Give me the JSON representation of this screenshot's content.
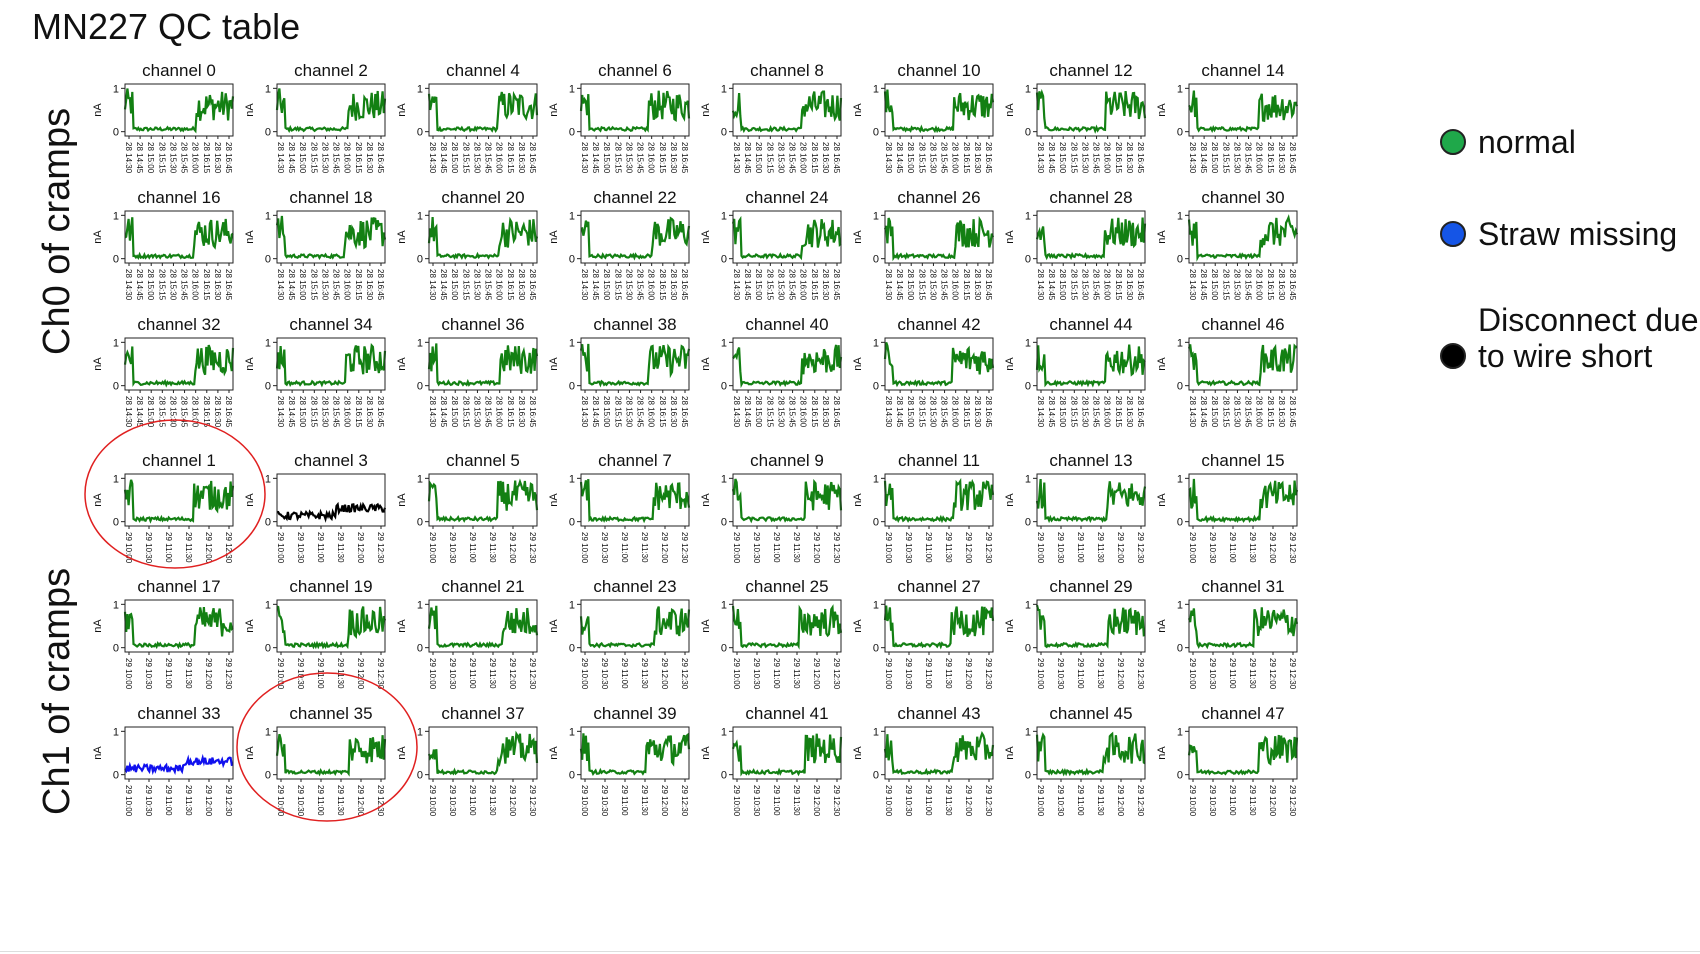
{
  "title": "MN227 QC table",
  "group_labels": {
    "ch0": "Ch0 of cramps",
    "ch1": "Ch1 of cramps"
  },
  "legend": [
    {
      "label": "normal",
      "color": "#1fa84a"
    },
    {
      "label": "Straw missing",
      "color": "#1555e6"
    },
    {
      "label": "Disconnect due",
      "label2": "to wire short",
      "color": "#000000"
    }
  ],
  "chart_data": {
    "type": "line",
    "ylabel": "nA",
    "yticks": [
      "0",
      "1"
    ],
    "ylim": [
      -0.1,
      1.1
    ],
    "xticks_ch0": [
      "28 14:30",
      "28 14:45",
      "28 15:00",
      "28 15:15",
      "28 15:30",
      "28 15:45",
      "28 16:00",
      "28 16:15",
      "28 16:30",
      "28 16:45"
    ],
    "xticks_ch1": [
      "29 10:00",
      "29 10:30",
      "29 11:00",
      "29 11:30",
      "29 12:00",
      "29 12:30"
    ],
    "colors": {
      "normal": "#138013",
      "missing": "#1010ee",
      "disconnect": "#000000"
    },
    "panels": [
      {
        "title": "channel 0",
        "status": "normal",
        "highlight": false
      },
      {
        "title": "channel 2",
        "status": "normal",
        "highlight": false
      },
      {
        "title": "channel 4",
        "status": "normal",
        "highlight": false
      },
      {
        "title": "channel 6",
        "status": "normal",
        "highlight": false
      },
      {
        "title": "channel 8",
        "status": "normal",
        "highlight": false
      },
      {
        "title": "channel 10",
        "status": "normal",
        "highlight": false
      },
      {
        "title": "channel 12",
        "status": "normal",
        "highlight": false
      },
      {
        "title": "channel 14",
        "status": "normal",
        "highlight": false
      },
      {
        "title": "channel 16",
        "status": "normal",
        "highlight": false
      },
      {
        "title": "channel 18",
        "status": "normal",
        "highlight": false
      },
      {
        "title": "channel 20",
        "status": "normal",
        "highlight": false
      },
      {
        "title": "channel 22",
        "status": "normal",
        "highlight": false
      },
      {
        "title": "channel 24",
        "status": "normal",
        "highlight": false
      },
      {
        "title": "channel 26",
        "status": "normal",
        "highlight": false
      },
      {
        "title": "channel 28",
        "status": "normal",
        "highlight": false
      },
      {
        "title": "channel 30",
        "status": "normal",
        "highlight": false
      },
      {
        "title": "channel 32",
        "status": "normal",
        "highlight": false
      },
      {
        "title": "channel 34",
        "status": "normal",
        "highlight": false
      },
      {
        "title": "channel 36",
        "status": "normal",
        "highlight": false
      },
      {
        "title": "channel 38",
        "status": "normal",
        "highlight": false
      },
      {
        "title": "channel 40",
        "status": "normal",
        "highlight": false
      },
      {
        "title": "channel 42",
        "status": "normal",
        "highlight": false
      },
      {
        "title": "channel 44",
        "status": "normal",
        "highlight": false
      },
      {
        "title": "channel 46",
        "status": "normal",
        "highlight": false
      },
      {
        "title": "channel 1",
        "status": "normal",
        "highlight": true
      },
      {
        "title": "channel 3",
        "status": "disconnect",
        "highlight": false
      },
      {
        "title": "channel 5",
        "status": "normal",
        "highlight": false
      },
      {
        "title": "channel 7",
        "status": "normal",
        "highlight": false
      },
      {
        "title": "channel 9",
        "status": "normal",
        "highlight": false
      },
      {
        "title": "channel 11",
        "status": "normal",
        "highlight": false
      },
      {
        "title": "channel 13",
        "status": "normal",
        "highlight": false
      },
      {
        "title": "channel 15",
        "status": "normal",
        "highlight": false
      },
      {
        "title": "channel 17",
        "status": "normal",
        "highlight": false
      },
      {
        "title": "channel 19",
        "status": "normal",
        "highlight": false
      },
      {
        "title": "channel 21",
        "status": "normal",
        "highlight": false
      },
      {
        "title": "channel 23",
        "status": "normal",
        "highlight": false
      },
      {
        "title": "channel 25",
        "status": "normal",
        "highlight": false
      },
      {
        "title": "channel 27",
        "status": "normal",
        "highlight": false
      },
      {
        "title": "channel 29",
        "status": "normal",
        "highlight": false
      },
      {
        "title": "channel 31",
        "status": "normal",
        "highlight": false
      },
      {
        "title": "channel 33",
        "status": "missing",
        "highlight": false
      },
      {
        "title": "channel 35",
        "status": "normal",
        "highlight": true
      },
      {
        "title": "channel 37",
        "status": "normal",
        "highlight": false
      },
      {
        "title": "channel 39",
        "status": "normal",
        "highlight": false
      },
      {
        "title": "channel 41",
        "status": "normal",
        "highlight": false
      },
      {
        "title": "channel 43",
        "status": "normal",
        "highlight": false
      },
      {
        "title": "channel 45",
        "status": "normal",
        "highlight": false
      },
      {
        "title": "channel 47",
        "status": "normal",
        "highlight": false
      }
    ]
  }
}
